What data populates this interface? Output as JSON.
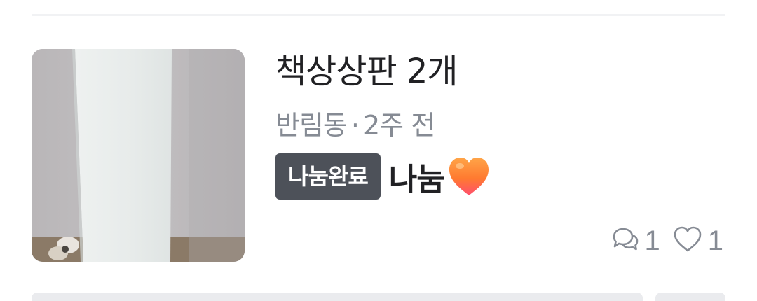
{
  "listing": {
    "title": "책상상판 2개",
    "location": "반림동",
    "separator": "·",
    "time": "2주 전",
    "status_badge": "나눔완료",
    "price": "나눔",
    "price_icon": "orange-heart-icon",
    "chat_count": "1",
    "like_count": "1",
    "thumbnail_icon": "product-photo"
  },
  "colors": {
    "title": "#212124",
    "meta": "#868b94",
    "badge_bg": "#4d5159",
    "badge_text": "#ffffff",
    "heart_orange": "#ff7e36"
  }
}
